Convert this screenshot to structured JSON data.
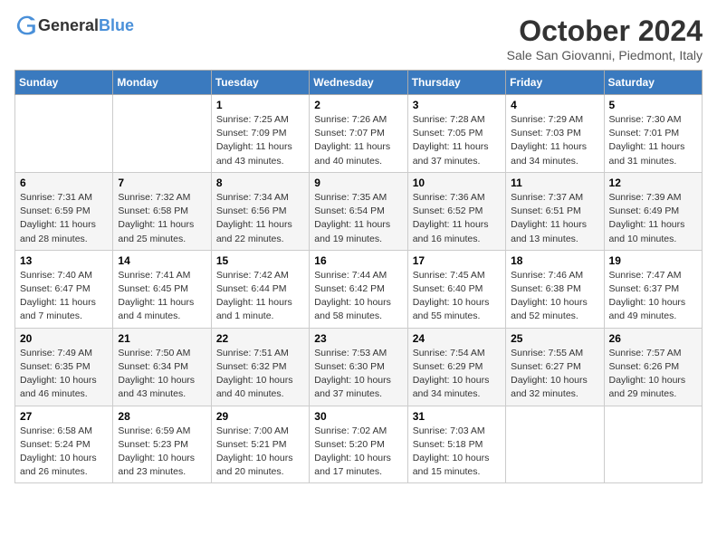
{
  "header": {
    "logo_general": "General",
    "logo_blue": "Blue",
    "month_title": "October 2024",
    "location": "Sale San Giovanni, Piedmont, Italy"
  },
  "weekdays": [
    "Sunday",
    "Monday",
    "Tuesday",
    "Wednesday",
    "Thursday",
    "Friday",
    "Saturday"
  ],
  "weeks": [
    [
      {
        "day": "",
        "sunrise": "",
        "sunset": "",
        "daylight": ""
      },
      {
        "day": "",
        "sunrise": "",
        "sunset": "",
        "daylight": ""
      },
      {
        "day": "1",
        "sunrise": "Sunrise: 7:25 AM",
        "sunset": "Sunset: 7:09 PM",
        "daylight": "Daylight: 11 hours and 43 minutes."
      },
      {
        "day": "2",
        "sunrise": "Sunrise: 7:26 AM",
        "sunset": "Sunset: 7:07 PM",
        "daylight": "Daylight: 11 hours and 40 minutes."
      },
      {
        "day": "3",
        "sunrise": "Sunrise: 7:28 AM",
        "sunset": "Sunset: 7:05 PM",
        "daylight": "Daylight: 11 hours and 37 minutes."
      },
      {
        "day": "4",
        "sunrise": "Sunrise: 7:29 AM",
        "sunset": "Sunset: 7:03 PM",
        "daylight": "Daylight: 11 hours and 34 minutes."
      },
      {
        "day": "5",
        "sunrise": "Sunrise: 7:30 AM",
        "sunset": "Sunset: 7:01 PM",
        "daylight": "Daylight: 11 hours and 31 minutes."
      }
    ],
    [
      {
        "day": "6",
        "sunrise": "Sunrise: 7:31 AM",
        "sunset": "Sunset: 6:59 PM",
        "daylight": "Daylight: 11 hours and 28 minutes."
      },
      {
        "day": "7",
        "sunrise": "Sunrise: 7:32 AM",
        "sunset": "Sunset: 6:58 PM",
        "daylight": "Daylight: 11 hours and 25 minutes."
      },
      {
        "day": "8",
        "sunrise": "Sunrise: 7:34 AM",
        "sunset": "Sunset: 6:56 PM",
        "daylight": "Daylight: 11 hours and 22 minutes."
      },
      {
        "day": "9",
        "sunrise": "Sunrise: 7:35 AM",
        "sunset": "Sunset: 6:54 PM",
        "daylight": "Daylight: 11 hours and 19 minutes."
      },
      {
        "day": "10",
        "sunrise": "Sunrise: 7:36 AM",
        "sunset": "Sunset: 6:52 PM",
        "daylight": "Daylight: 11 hours and 16 minutes."
      },
      {
        "day": "11",
        "sunrise": "Sunrise: 7:37 AM",
        "sunset": "Sunset: 6:51 PM",
        "daylight": "Daylight: 11 hours and 13 minutes."
      },
      {
        "day": "12",
        "sunrise": "Sunrise: 7:39 AM",
        "sunset": "Sunset: 6:49 PM",
        "daylight": "Daylight: 11 hours and 10 minutes."
      }
    ],
    [
      {
        "day": "13",
        "sunrise": "Sunrise: 7:40 AM",
        "sunset": "Sunset: 6:47 PM",
        "daylight": "Daylight: 11 hours and 7 minutes."
      },
      {
        "day": "14",
        "sunrise": "Sunrise: 7:41 AM",
        "sunset": "Sunset: 6:45 PM",
        "daylight": "Daylight: 11 hours and 4 minutes."
      },
      {
        "day": "15",
        "sunrise": "Sunrise: 7:42 AM",
        "sunset": "Sunset: 6:44 PM",
        "daylight": "Daylight: 11 hours and 1 minute."
      },
      {
        "day": "16",
        "sunrise": "Sunrise: 7:44 AM",
        "sunset": "Sunset: 6:42 PM",
        "daylight": "Daylight: 10 hours and 58 minutes."
      },
      {
        "day": "17",
        "sunrise": "Sunrise: 7:45 AM",
        "sunset": "Sunset: 6:40 PM",
        "daylight": "Daylight: 10 hours and 55 minutes."
      },
      {
        "day": "18",
        "sunrise": "Sunrise: 7:46 AM",
        "sunset": "Sunset: 6:38 PM",
        "daylight": "Daylight: 10 hours and 52 minutes."
      },
      {
        "day": "19",
        "sunrise": "Sunrise: 7:47 AM",
        "sunset": "Sunset: 6:37 PM",
        "daylight": "Daylight: 10 hours and 49 minutes."
      }
    ],
    [
      {
        "day": "20",
        "sunrise": "Sunrise: 7:49 AM",
        "sunset": "Sunset: 6:35 PM",
        "daylight": "Daylight: 10 hours and 46 minutes."
      },
      {
        "day": "21",
        "sunrise": "Sunrise: 7:50 AM",
        "sunset": "Sunset: 6:34 PM",
        "daylight": "Daylight: 10 hours and 43 minutes."
      },
      {
        "day": "22",
        "sunrise": "Sunrise: 7:51 AM",
        "sunset": "Sunset: 6:32 PM",
        "daylight": "Daylight: 10 hours and 40 minutes."
      },
      {
        "day": "23",
        "sunrise": "Sunrise: 7:53 AM",
        "sunset": "Sunset: 6:30 PM",
        "daylight": "Daylight: 10 hours and 37 minutes."
      },
      {
        "day": "24",
        "sunrise": "Sunrise: 7:54 AM",
        "sunset": "Sunset: 6:29 PM",
        "daylight": "Daylight: 10 hours and 34 minutes."
      },
      {
        "day": "25",
        "sunrise": "Sunrise: 7:55 AM",
        "sunset": "Sunset: 6:27 PM",
        "daylight": "Daylight: 10 hours and 32 minutes."
      },
      {
        "day": "26",
        "sunrise": "Sunrise: 7:57 AM",
        "sunset": "Sunset: 6:26 PM",
        "daylight": "Daylight: 10 hours and 29 minutes."
      }
    ],
    [
      {
        "day": "27",
        "sunrise": "Sunrise: 6:58 AM",
        "sunset": "Sunset: 5:24 PM",
        "daylight": "Daylight: 10 hours and 26 minutes."
      },
      {
        "day": "28",
        "sunrise": "Sunrise: 6:59 AM",
        "sunset": "Sunset: 5:23 PM",
        "daylight": "Daylight: 10 hours and 23 minutes."
      },
      {
        "day": "29",
        "sunrise": "Sunrise: 7:00 AM",
        "sunset": "Sunset: 5:21 PM",
        "daylight": "Daylight: 10 hours and 20 minutes."
      },
      {
        "day": "30",
        "sunrise": "Sunrise: 7:02 AM",
        "sunset": "Sunset: 5:20 PM",
        "daylight": "Daylight: 10 hours and 17 minutes."
      },
      {
        "day": "31",
        "sunrise": "Sunrise: 7:03 AM",
        "sunset": "Sunset: 5:18 PM",
        "daylight": "Daylight: 10 hours and 15 minutes."
      },
      {
        "day": "",
        "sunrise": "",
        "sunset": "",
        "daylight": ""
      },
      {
        "day": "",
        "sunrise": "",
        "sunset": "",
        "daylight": ""
      }
    ]
  ]
}
